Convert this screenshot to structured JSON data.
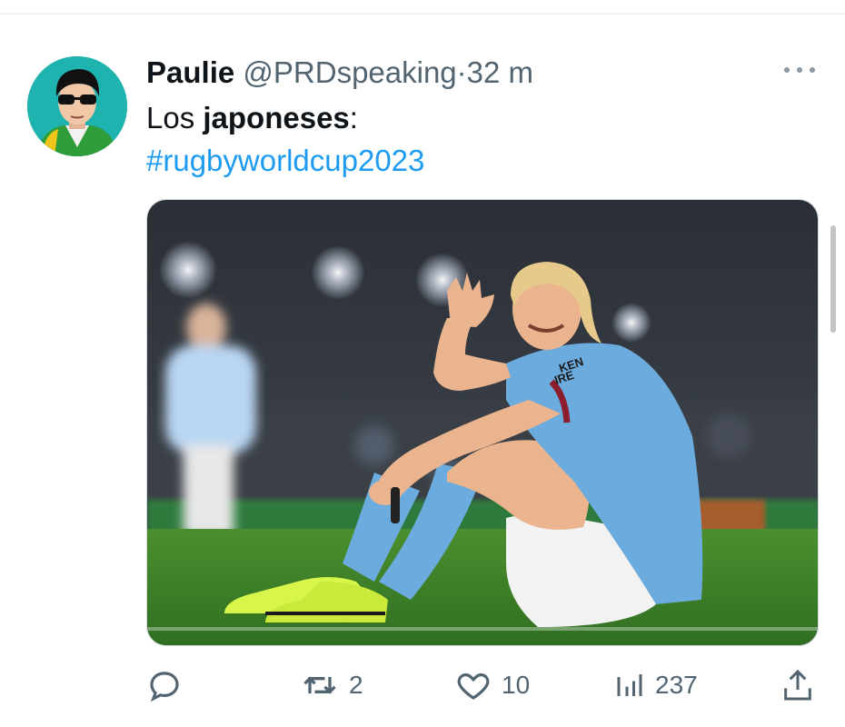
{
  "tweet": {
    "display_name": "Paulie",
    "handle": "@PRDspeaking",
    "separator": "·",
    "time": "32 m",
    "text_prefix": "Los ",
    "text_bold": "japoneses",
    "text_suffix": ":",
    "hashtag": "#rugbyworldcup2023",
    "jersey_text": "KEN\nIRE"
  },
  "actions": {
    "reply_icon": "reply-icon",
    "retweet_count": "2",
    "like_count": "10",
    "views_count": "237",
    "share_icon": "share-icon"
  },
  "colors": {
    "link": "#1d9bf0",
    "secondary_text": "#536471",
    "avatar_bg": "#1fb3b0",
    "jersey": "#6cabdd",
    "pitch": "#3f8a2a"
  }
}
